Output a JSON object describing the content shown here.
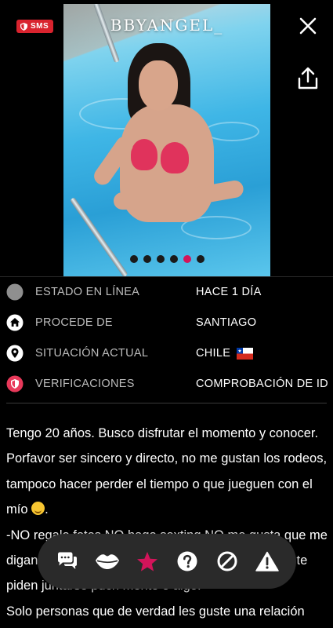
{
  "profile": {
    "username": "BBYANGEL_",
    "badge": "SMS",
    "photo_count": 6,
    "active_photo_index": 4
  },
  "info_rows": [
    {
      "icon": "status-dot-icon",
      "label": "ESTADO EN LÍNEA",
      "value": "HACE 1 DÍA"
    },
    {
      "icon": "home-icon",
      "label": "PROCEDE DE",
      "value": "SANTIAGO"
    },
    {
      "icon": "location-pin-icon",
      "label": "SITUACIÓN ACTUAL",
      "value": "CHILE",
      "flag": "chile-flag-icon"
    },
    {
      "icon": "shield-icon",
      "label": "VERIFICACIONES",
      "value": "COMPROBACIÓN DE ID"
    }
  ],
  "description": {
    "line1": "Tengo 20 años. Busco disfrutar el momento y conocer.",
    "line2": "Porfavor ser sincero y directo, no me gustan los rodeos,",
    "line3": "tampoco hacer perder el tiempo o que jueguen con el",
    "line4a": "mío ",
    "line4b": ".",
    "line5": "-NO regalo fotos NO hago sexting NO me gusta que me",
    "line6a": "digan",
    "line6b": "que te",
    "line7": "piden juntarse pucn mente o algo.",
    "line8": "Solo personas que de verdad les guste una relación"
  },
  "actions": [
    {
      "icon": "chat-bubbles-icon"
    },
    {
      "icon": "lips-icon"
    },
    {
      "icon": "star-icon"
    },
    {
      "icon": "help-icon"
    },
    {
      "icon": "block-icon"
    },
    {
      "icon": "warning-icon"
    }
  ],
  "colors": {
    "accent": "#d3145a",
    "badge_red": "#d9232e",
    "star": "#d3145a",
    "background": "#000000",
    "bar": "#2a2a2a"
  }
}
